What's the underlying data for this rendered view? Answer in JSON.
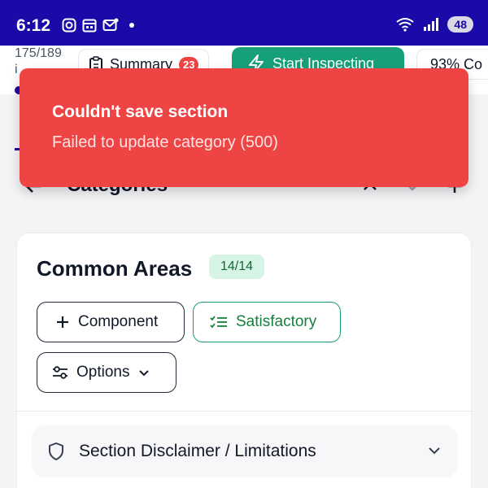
{
  "status_bar": {
    "time": "6:12",
    "battery": "48",
    "icons": [
      "instagram-icon",
      "calendar-icon",
      "mail-icon",
      "wifi-icon",
      "signal-icon",
      "battery-icon"
    ]
  },
  "header": {
    "progress_text": "175/189",
    "progress_suffix": "i",
    "summary_label": "Summary",
    "summary_badge": "23",
    "start_label": "Start Inspecting",
    "percent_label": "93% Co"
  },
  "categories": {
    "title": "Categories"
  },
  "card": {
    "title": "Common Areas",
    "count": "14/14",
    "component_label": "Component",
    "satisfactory_label": "Satisfactory",
    "options_label": "Options",
    "section_label": "Section Disclaimer / Limitations"
  },
  "toast": {
    "title": "Couldn't save section",
    "message": "Failed to update category (500)"
  },
  "colors": {
    "status_bar": "#1a0aa8",
    "accent_green": "#16a07a",
    "toast_red": "#ef4444"
  }
}
